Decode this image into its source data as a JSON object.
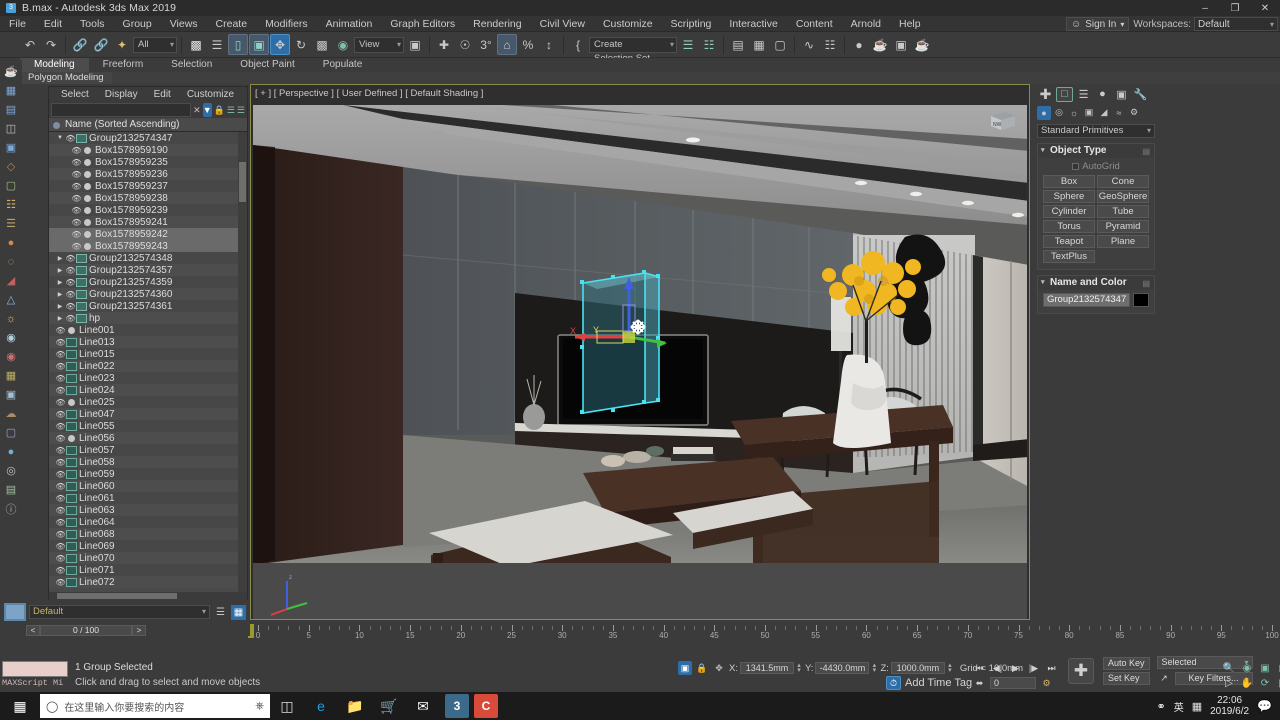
{
  "window": {
    "title": "B.max - Autodesk 3ds Max 2019",
    "app_icon": "3",
    "minimize": "–",
    "maximize": "❐",
    "close": "✕"
  },
  "menubar": {
    "items": [
      "File",
      "Edit",
      "Tools",
      "Group",
      "Views",
      "Create",
      "Modifiers",
      "Animation",
      "Graph Editors",
      "Rendering",
      "Civil View",
      "Customize",
      "Scripting",
      "Interactive",
      "Content",
      "Arnold",
      "Help"
    ],
    "sign_in": "Sign In",
    "workspaces_label": "Workspaces:",
    "workspace_value": "Default"
  },
  "toolbar": {
    "selection_filter": "All",
    "view_dropdown": "View",
    "selection_set": "Create Selection Set",
    "icons": [
      "undo-icon",
      "redo-icon",
      "link-icon",
      "unlink-icon",
      "bind-space-warp-icon",
      "select-object-icon",
      "select-by-name-icon",
      "rectangular-region-icon",
      "window-crossing-icon",
      "select-and-move-icon",
      "select-and-rotate-icon",
      "select-and-scale-icon",
      "placement-icon",
      "ref-coord-icon",
      "use-pivot-icon",
      "named-selection-icon",
      "mirror-icon",
      "align-icon",
      "layer-explorer-icon",
      "scene-explorer-icon",
      "curve-editor-icon",
      "schematic-view-icon",
      "material-editor-icon",
      "render-setup-icon",
      "render-frame-icon",
      "render-production-icon"
    ]
  },
  "ribbon": {
    "tabs": [
      "Modeling",
      "Freeform",
      "Selection",
      "Object Paint",
      "Populate"
    ],
    "active_tab": "Modeling",
    "subtitle": "Polygon Modeling"
  },
  "scene_explorer": {
    "menu": [
      "Select",
      "Display",
      "Edit",
      "Customize"
    ],
    "search_value": "",
    "search_placeholder": "",
    "clear_icon": "✕",
    "filter_icon": "filter-icon",
    "lock_icon": "lock-icon",
    "column_header": "Name (Sorted Ascending)",
    "items": [
      {
        "name": "Group2132574347",
        "depth": 0,
        "type": "group",
        "expanded": true,
        "selected": false
      },
      {
        "name": "Box1578959190",
        "depth": 1,
        "type": "box",
        "expanded": false,
        "selected": false
      },
      {
        "name": "Box1578959235",
        "depth": 1,
        "type": "box",
        "expanded": false,
        "selected": false
      },
      {
        "name": "Box1578959236",
        "depth": 1,
        "type": "box",
        "expanded": false,
        "selected": false
      },
      {
        "name": "Box1578959237",
        "depth": 1,
        "type": "box",
        "expanded": false,
        "selected": false
      },
      {
        "name": "Box1578959238",
        "depth": 1,
        "type": "box",
        "expanded": false,
        "selected": false
      },
      {
        "name": "Box1578959239",
        "depth": 1,
        "type": "box",
        "expanded": false,
        "selected": false
      },
      {
        "name": "Box1578959241",
        "depth": 1,
        "type": "box",
        "expanded": false,
        "selected": false
      },
      {
        "name": "Box1578959242",
        "depth": 1,
        "type": "box",
        "expanded": false,
        "selected": true
      },
      {
        "name": "Box1578959243",
        "depth": 1,
        "type": "box",
        "expanded": false,
        "selected": true
      },
      {
        "name": "Group2132574348",
        "depth": 0,
        "type": "group",
        "expanded": false,
        "selected": false
      },
      {
        "name": "Group2132574357",
        "depth": 0,
        "type": "group",
        "expanded": false,
        "selected": false
      },
      {
        "name": "Group2132574359",
        "depth": 0,
        "type": "group",
        "expanded": false,
        "selected": false
      },
      {
        "name": "Group2132574360",
        "depth": 0,
        "type": "group",
        "expanded": false,
        "selected": false
      },
      {
        "name": "Group2132574361",
        "depth": 0,
        "type": "group",
        "expanded": false,
        "selected": false
      },
      {
        "name": "hp",
        "depth": 0,
        "type": "group",
        "expanded": false,
        "selected": false
      },
      {
        "name": "Line001",
        "depth": 0,
        "type": "box",
        "expanded": false,
        "selected": false
      },
      {
        "name": "Line013",
        "depth": 0,
        "type": "line",
        "expanded": false,
        "selected": false
      },
      {
        "name": "Line015",
        "depth": 0,
        "type": "line",
        "expanded": false,
        "selected": false
      },
      {
        "name": "Line022",
        "depth": 0,
        "type": "line",
        "expanded": false,
        "selected": false
      },
      {
        "name": "Line023",
        "depth": 0,
        "type": "line",
        "expanded": false,
        "selected": false
      },
      {
        "name": "Line024",
        "depth": 0,
        "type": "line",
        "expanded": false,
        "selected": false
      },
      {
        "name": "Line025",
        "depth": 0,
        "type": "box",
        "expanded": false,
        "selected": false
      },
      {
        "name": "Line047",
        "depth": 0,
        "type": "line",
        "expanded": false,
        "selected": false
      },
      {
        "name": "Line055",
        "depth": 0,
        "type": "line",
        "expanded": false,
        "selected": false
      },
      {
        "name": "Line056",
        "depth": 0,
        "type": "box",
        "expanded": false,
        "selected": false
      },
      {
        "name": "Line057",
        "depth": 0,
        "type": "line",
        "expanded": false,
        "selected": false
      },
      {
        "name": "Line058",
        "depth": 0,
        "type": "line",
        "expanded": false,
        "selected": false
      },
      {
        "name": "Line059",
        "depth": 0,
        "type": "line",
        "expanded": false,
        "selected": false
      },
      {
        "name": "Line060",
        "depth": 0,
        "type": "line",
        "expanded": false,
        "selected": false
      },
      {
        "name": "Line061",
        "depth": 0,
        "type": "line",
        "expanded": false,
        "selected": false
      },
      {
        "name": "Line063",
        "depth": 0,
        "type": "line",
        "expanded": false,
        "selected": false
      },
      {
        "name": "Line064",
        "depth": 0,
        "type": "line",
        "expanded": false,
        "selected": false
      },
      {
        "name": "Line068",
        "depth": 0,
        "type": "line",
        "expanded": false,
        "selected": false
      },
      {
        "name": "Line069",
        "depth": 0,
        "type": "line",
        "expanded": false,
        "selected": false
      },
      {
        "name": "Line070",
        "depth": 0,
        "type": "line",
        "expanded": false,
        "selected": false
      },
      {
        "name": "Line071",
        "depth": 0,
        "type": "line",
        "expanded": false,
        "selected": false
      },
      {
        "name": "Line072",
        "depth": 0,
        "type": "line",
        "expanded": false,
        "selected": false
      }
    ]
  },
  "viewport": {
    "label": "[ + ] [ Perspective ] [ User Defined ] [ Default Shading ]",
    "viewcube_label": "NW",
    "gizmo": {
      "x_label": "X",
      "y_label": "Y",
      "z_label": "Z"
    }
  },
  "command_panel": {
    "tabs": [
      "create-tab",
      "modify-tab",
      "hierarchy-tab",
      "motion-tab",
      "display-tab",
      "utilities-tab"
    ],
    "active_tab": "create-tab",
    "subcategory_icons": [
      "geometry-icon",
      "shapes-icon",
      "lights-icon",
      "cameras-icon",
      "helpers-icon",
      "space-warps-icon",
      "systems-icon"
    ],
    "category_dropdown": "Standard Primitives",
    "object_type": {
      "title": "Object Type",
      "autogrid_label": "AutoGrid",
      "buttons": [
        "Box",
        "Cone",
        "Sphere",
        "GeoSphere",
        "Cylinder",
        "Tube",
        "Torus",
        "Pyramid",
        "Teapot",
        "Plane",
        "TextPlus"
      ]
    },
    "name_and_color": {
      "title": "Name and Color",
      "name_value": "Group2132574347",
      "color": "#000000"
    }
  },
  "layer_bar": {
    "layer_name": "Default",
    "icon_left": "layer-swatch",
    "icons": [
      "layer-manager-icon",
      "layer-explorer-icon"
    ]
  },
  "timeline": {
    "frame_display": "0 / 100",
    "prev_label": "<",
    "next_label": ">",
    "start": 0,
    "end": 100,
    "current": 0,
    "major_labels": [
      0,
      5,
      10,
      15,
      20,
      25,
      30,
      35,
      40,
      45,
      50,
      55,
      60,
      65,
      70,
      75,
      80,
      85,
      90,
      95,
      100
    ]
  },
  "status_bar": {
    "maxscript_label": "MAXScript Mi",
    "selection_status": "1 Group Selected",
    "prompt": "Click and drag to select and move objects",
    "coords": {
      "x_label": "X:",
      "x_value": "1341.5mm",
      "y_label": "Y:",
      "y_value": "-4430.0mm",
      "z_label": "Z:",
      "z_value": "1000.0mm",
      "grid_label": "Grid = 10.0mm"
    },
    "add_time_tag": "Add Time Tag",
    "animation": {
      "frame_value": "0",
      "auto_key": "Auto Key",
      "set_key": "Set Key",
      "key_mode": "Selected",
      "key_filters": "Key Filters..."
    }
  },
  "taskbar": {
    "search_placeholder": "在这里输入你要搜索的内容",
    "apps": [
      "task-view-icon",
      "edge-icon",
      "file-explorer-icon",
      "store-icon",
      "mail-icon",
      "3dsmax-icon",
      "cdr-icon"
    ],
    "tray": {
      "ime": "英",
      "time": "22:06",
      "date": "2019/6/2"
    }
  },
  "colors": {
    "accent": "#2e6ea8",
    "viewport_border": "#8a8a4a",
    "selected_row": "#6a6a6a",
    "gizmo_x": "#e04040",
    "gizmo_y": "#40c040",
    "gizmo_z": "#4060e0"
  }
}
